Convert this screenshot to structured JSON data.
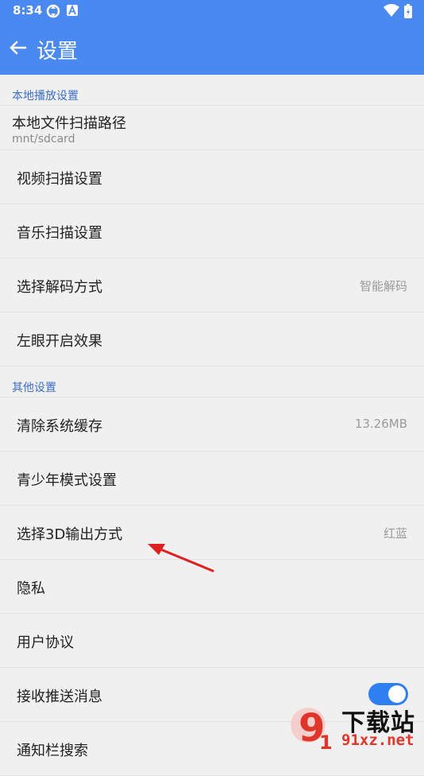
{
  "status_bar": {
    "time": "8:34"
  },
  "app_bar": {
    "title": "设置"
  },
  "sections": {
    "local": {
      "header": "本地播放设置",
      "path_label": "本地文件扫描路径",
      "path_value": "mnt/sdcard",
      "video_scan": "视频扫描设置",
      "music_scan": "音乐扫描设置",
      "decode_label": "选择解码方式",
      "decode_value": "智能解码",
      "left_eye": "左眼开启效果"
    },
    "other": {
      "header": "其他设置",
      "cache_label": "清除系统缓存",
      "cache_value": "13.26MB",
      "youth_mode": "青少年模式设置",
      "output3d_label": "选择3D输出方式",
      "output3d_value": "红蓝",
      "privacy": "隐私",
      "agreement": "用户协议",
      "push_label": "接收推送消息",
      "push_enabled": true,
      "cutoff_label": "通知栏搜索"
    }
  },
  "colors": {
    "accent": "#4a88f2",
    "toggle_on": "#2f7ff3",
    "section_header": "#3d6fc6",
    "annotation": "#e02020"
  },
  "watermark": {
    "title": "下载站",
    "url": "91xz.net",
    "logo_text": "9"
  }
}
